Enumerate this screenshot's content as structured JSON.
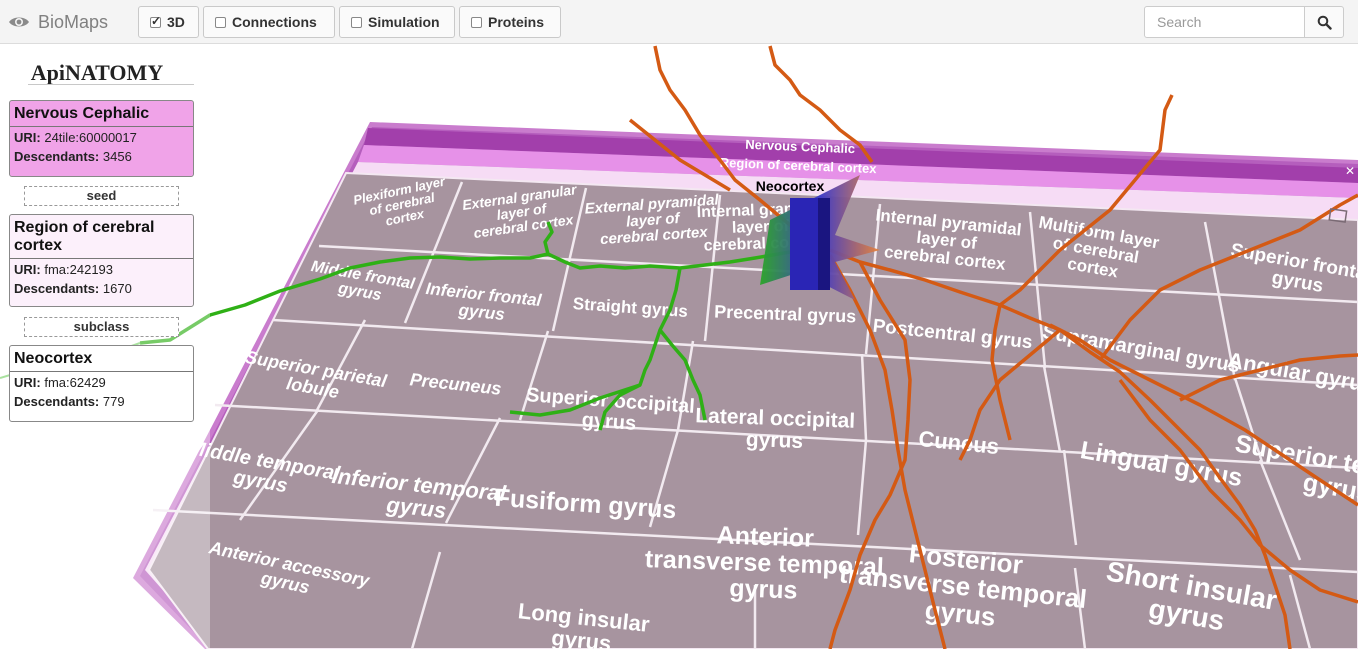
{
  "app": {
    "title": "BioMaps",
    "icon": "eye-icon"
  },
  "toolbar": {
    "buttons": [
      {
        "label": "3D",
        "checked": true
      },
      {
        "label": "Connections",
        "checked": false
      },
      {
        "label": "Simulation",
        "checked": false
      },
      {
        "label": "Proteins",
        "checked": false
      }
    ]
  },
  "search": {
    "placeholder": "Search",
    "button_icon": "search-icon"
  },
  "panel": {
    "title": "ApiNATOMY",
    "cards": [
      {
        "title": "Nervous Cephalic",
        "uri_label": "URI:",
        "uri": "24tile:60000017",
        "desc_label": "Descendants:",
        "descendants": "3456",
        "bg": "#f0a3e8"
      },
      {
        "title": "Region of cerebral cortex",
        "uri_label": "URI:",
        "uri": "fma:242193",
        "desc_label": "Descendants:",
        "descendants": "1670",
        "bg": "#fcf0fb"
      },
      {
        "title": "Neocortex",
        "uri_label": "URI:",
        "uri": "fma:62429",
        "desc_label": "Descendants:",
        "descendants": "779",
        "bg": "#ffffff"
      }
    ],
    "relations": [
      "seed",
      "subclass"
    ]
  },
  "scene": {
    "header1": "Nervous Cephalic",
    "header2": "Region of cerebral cortex",
    "neocortex_label": "Neocortex",
    "tiles": [
      "Plexiform layer of cerebral cortex",
      "External granular layer of cerebral cortex",
      "External pyramidal layer of cerebral cortex",
      "Internal granular layer of cerebral cortex",
      "Internal pyramidal layer of cerebral cortex",
      "Multiform layer of cerebral cortex",
      "Superior frontal gyrus",
      "Middle frontal gyrus",
      "Inferior frontal gyrus",
      "Straight gyrus",
      "Precentral gyrus",
      "Postcentral gyrus",
      "Supramarginal gyrus",
      "Anguiar gyrus",
      "Superior parietal lobule",
      "Precuneus",
      "Superior occipital gyrus",
      "Lateral occipital gyrus",
      "Cuneus",
      "Lingual gyrus",
      "Superior temporal gyrus",
      "Middle temporal gyrus",
      "Inferior temporal gyrus",
      "Fusiform gyrus",
      "Anterior transverse temporal gyrus",
      "Posterior transverse temporal gyrus",
      "Short insular gyrus",
      "Anterior accessory gyrus",
      "Long insular gyrus"
    ],
    "colors": {
      "plate": "#a7949f",
      "frame": "#b85ec0",
      "orange": "#d45a14",
      "green": "#2fb016",
      "blue": "#2a25b5"
    }
  }
}
